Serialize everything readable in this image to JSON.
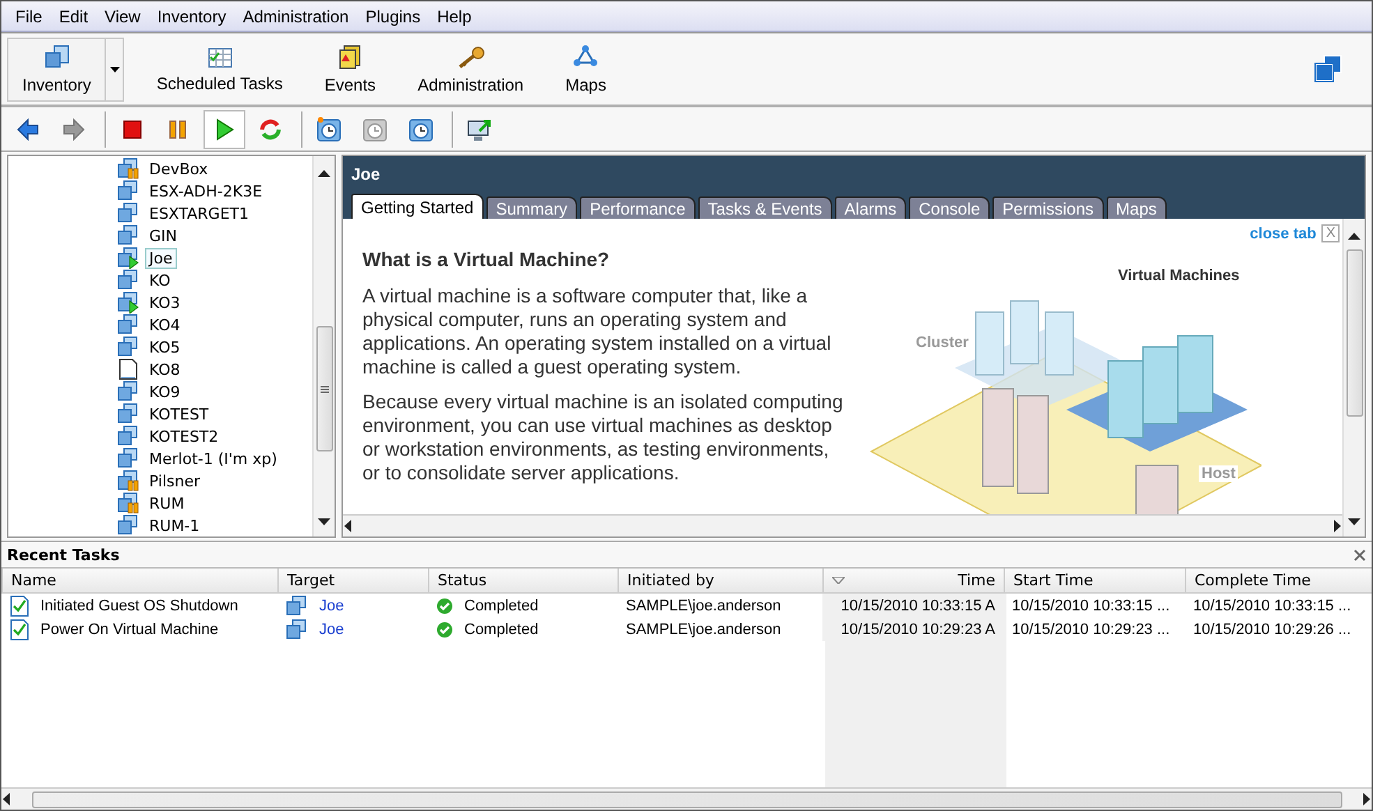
{
  "menu": [
    "File",
    "Edit",
    "View",
    "Inventory",
    "Administration",
    "Plugins",
    "Help"
  ],
  "nav_buttons": [
    {
      "label": "Inventory",
      "kind": "inventory",
      "selected": true
    },
    {
      "label": "Scheduled Tasks",
      "kind": "tasks",
      "selected": false
    },
    {
      "label": "Events",
      "kind": "events",
      "selected": false
    },
    {
      "label": "Administration",
      "kind": "admin",
      "selected": false
    },
    {
      "label": "Maps",
      "kind": "maps",
      "selected": false
    }
  ],
  "actions": [
    {
      "kind": "back",
      "disabled": false,
      "pressed": false
    },
    {
      "kind": "forward",
      "disabled": true,
      "pressed": false
    },
    {
      "kind": "stop",
      "disabled": false,
      "pressed": false
    },
    {
      "kind": "pause",
      "disabled": false,
      "pressed": false
    },
    {
      "kind": "play",
      "disabled": false,
      "pressed": true
    },
    {
      "kind": "reset",
      "disabled": false,
      "pressed": false
    },
    {
      "kind": "snapshot",
      "disabled": false,
      "pressed": false
    },
    {
      "kind": "revert",
      "disabled": true,
      "pressed": false
    },
    {
      "kind": "manage",
      "disabled": false,
      "pressed": false
    },
    {
      "kind": "console",
      "disabled": false,
      "pressed": false
    }
  ],
  "tree": [
    {
      "label": "DevBox",
      "kind": "paused",
      "selected": false
    },
    {
      "label": "ESX-ADH-2K3E",
      "kind": "vm",
      "selected": false
    },
    {
      "label": "ESXTARGET1",
      "kind": "vm",
      "selected": false
    },
    {
      "label": "GIN",
      "kind": "vm",
      "selected": false
    },
    {
      "label": "Joe",
      "kind": "running",
      "selected": true
    },
    {
      "label": "KO",
      "kind": "vm",
      "selected": false
    },
    {
      "label": "KO3",
      "kind": "running",
      "selected": false
    },
    {
      "label": "KO4",
      "kind": "vm",
      "selected": false
    },
    {
      "label": "KO5",
      "kind": "vm",
      "selected": false
    },
    {
      "label": "KO8",
      "kind": "template",
      "selected": false
    },
    {
      "label": "KO9",
      "kind": "vm",
      "selected": false
    },
    {
      "label": "KOTEST",
      "kind": "vm",
      "selected": false
    },
    {
      "label": "KOTEST2",
      "kind": "vm",
      "selected": false
    },
    {
      "label": "Merlot-1 (I'm xp)",
      "kind": "vm",
      "selected": false
    },
    {
      "label": "Pilsner",
      "kind": "paused",
      "selected": false
    },
    {
      "label": "RUM",
      "kind": "paused",
      "selected": false
    },
    {
      "label": "RUM-1",
      "kind": "vm",
      "selected": false
    }
  ],
  "detail": {
    "title": "Joe",
    "tabs": [
      {
        "label": "Getting Started",
        "selected": true
      },
      {
        "label": "Summary",
        "selected": false
      },
      {
        "label": "Performance",
        "selected": false
      },
      {
        "label": "Tasks & Events",
        "selected": false
      },
      {
        "label": "Alarms",
        "selected": false
      },
      {
        "label": "Console",
        "selected": false
      },
      {
        "label": "Permissions",
        "selected": false
      },
      {
        "label": "Maps",
        "selected": false
      }
    ],
    "close_tab": "close tab",
    "close_x": "X",
    "heading": "What is a Virtual Machine?",
    "paragraphs": [
      "A virtual machine is a software computer that, like a physical computer, runs an operating system and applications. An operating system installed on a virtual machine is called a guest operating system.",
      "Because every virtual machine is an isolated computing environment, you can use virtual machines as desktop or workstation environments, as testing environments, or to consolidate server applications."
    ],
    "diagram_labels": [
      "Virtual Machines",
      "Cluster",
      "Host"
    ]
  },
  "recent_tasks": {
    "title": "Recent Tasks",
    "columns": [
      {
        "label": "Name",
        "sorted": false
      },
      {
        "label": "Target",
        "sorted": false
      },
      {
        "label": "Status",
        "sorted": false
      },
      {
        "label": "Initiated by",
        "sorted": false
      },
      {
        "label": "Time",
        "sorted": true
      },
      {
        "label": "Start Time",
        "sorted": false
      },
      {
        "label": "Complete Time",
        "sorted": false
      }
    ],
    "rows": [
      {
        "name": "Initiated Guest OS Shutdown",
        "target": "Joe",
        "status": "Completed",
        "initiated_by": "SAMPLE\\joe.anderson",
        "time": "10/15/2010 10:33:15 A",
        "start_time": "10/15/2010 10:33:15 ...",
        "complete_time": "10/15/2010 10:33:15 ..."
      },
      {
        "name": "Power On Virtual Machine",
        "target": "Joe",
        "status": "Completed",
        "initiated_by": "SAMPLE\\joe.anderson",
        "time": "10/15/2010 10:29:23 A",
        "start_time": "10/15/2010 10:29:23 ...",
        "complete_time": "10/15/2010 10:29:26 ..."
      }
    ]
  }
}
